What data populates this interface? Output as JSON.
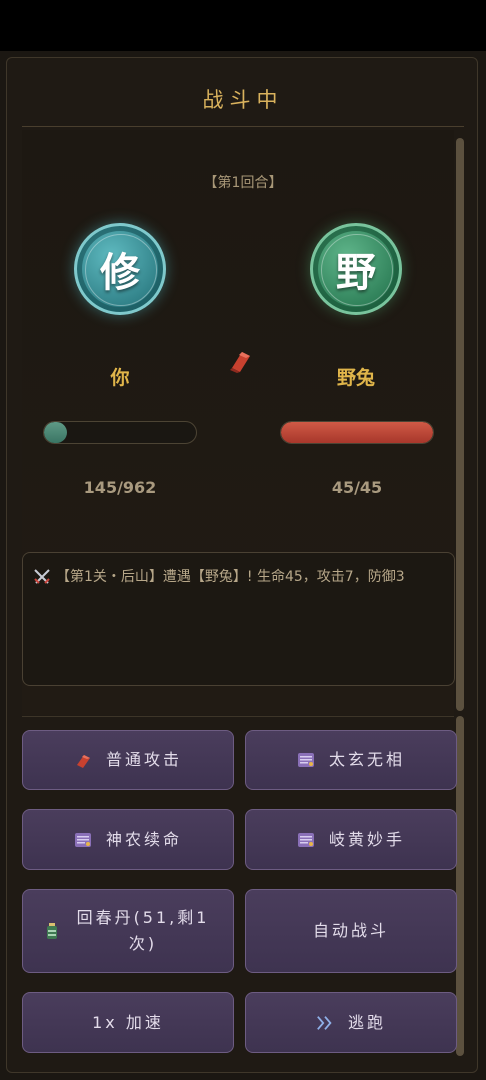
{
  "header": {
    "title": "战斗中"
  },
  "battle": {
    "round_label": "【第1回合】",
    "player": {
      "avatar_char": "修",
      "name": "你",
      "hp_text": "145/962",
      "hp_fraction": 0.151
    },
    "enemy": {
      "avatar_char": "野",
      "name": "野兔",
      "hp_text": "45/45",
      "hp_fraction": 1.0
    },
    "vs_icon": "red-crystal-icon"
  },
  "log": {
    "entries": [
      {
        "icon": "crossed-swords-icon",
        "text": "【第1关・后山】遭遇【野兔】! 生命45，攻击7，防御3"
      }
    ]
  },
  "actions": {
    "normal_attack": {
      "label": "普通攻击",
      "icon": "red-crystal-icon"
    },
    "taixuan": {
      "label": "太玄无相",
      "icon": "skill-scroll-icon"
    },
    "shennong": {
      "label": "神农续命",
      "icon": "skill-scroll-icon"
    },
    "qihuang": {
      "label": "岐黄妙手",
      "icon": "skill-scroll-icon"
    },
    "huichun": {
      "label": "回春丹(51,剩1次)",
      "icon": "potion-bottle-icon"
    },
    "auto_battle": {
      "label": "自动战斗"
    },
    "speed": {
      "label": "1x 加速"
    },
    "flee": {
      "label": "逃跑",
      "icon": "double-chevron-icon"
    }
  },
  "colors": {
    "accent_gold": "#d9b25d",
    "player_hp": "#3a7564",
    "enemy_hp": "#c04a3a",
    "button_bg": "#443858"
  }
}
